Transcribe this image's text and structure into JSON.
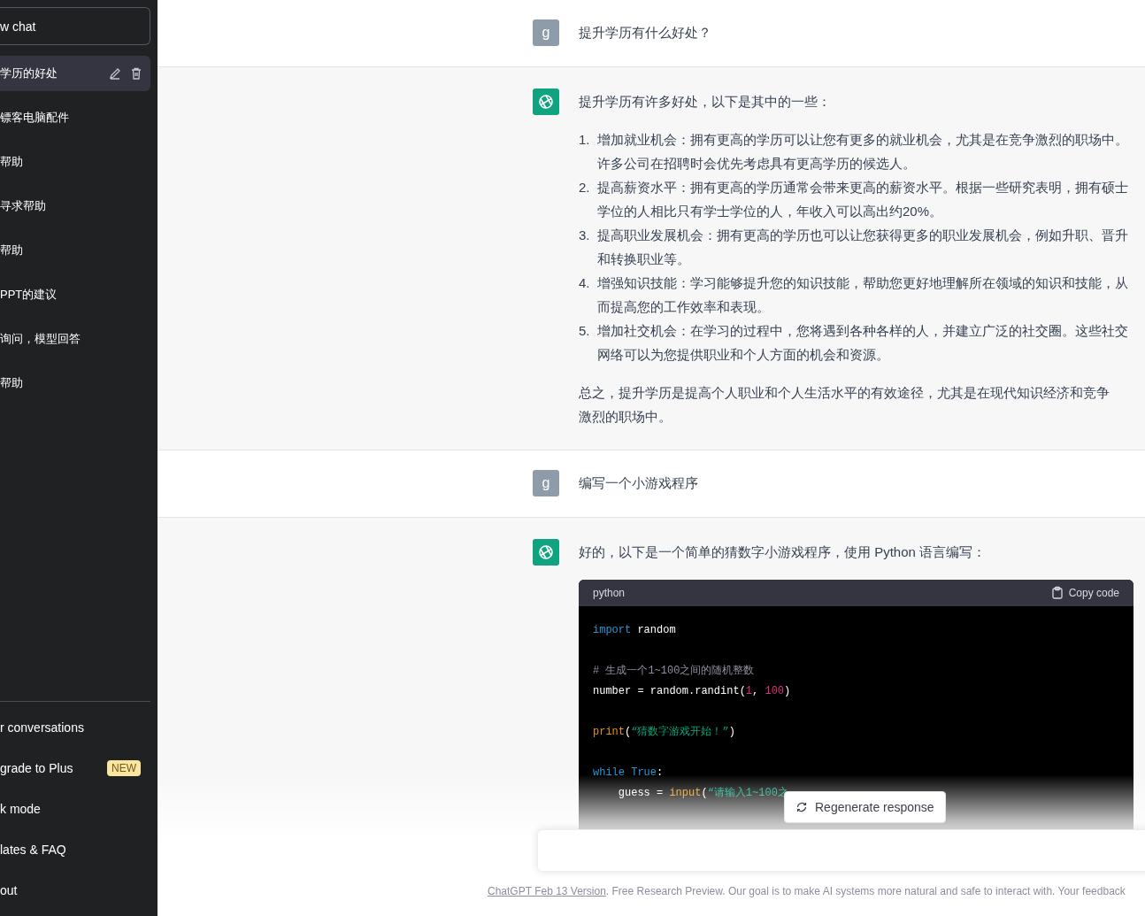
{
  "sidebar": {
    "new_chat": "w chat",
    "conversations": [
      {
        "title": "学历的好处",
        "selected": true
      },
      {
        "title": "镖客电脑配件",
        "selected": false
      },
      {
        "title": "帮助",
        "selected": false
      },
      {
        "title": "寻求帮助",
        "selected": false
      },
      {
        "title": "帮助",
        "selected": false
      },
      {
        "title": "PPT的建议",
        "selected": false
      },
      {
        "title": "询问，模型回答",
        "selected": false
      },
      {
        "title": "帮助",
        "selected": false
      }
    ],
    "menu": [
      {
        "label": "r conversations"
      },
      {
        "label": "grade to Plus",
        "badge": "NEW"
      },
      {
        "label": "k mode"
      },
      {
        "label": "lates & FAQ"
      },
      {
        "label": "out"
      }
    ]
  },
  "messages": [
    {
      "kind": "user",
      "avatar": "g",
      "text": "提升学历有什么好处？"
    },
    {
      "kind": "assistant",
      "intro": "提升学历有许多好处，以下是其中的一些：",
      "list": [
        {
          "number": "1.",
          "text": "增加就业机会：拥有更高的学历可以让您有更多的就业机会，尤其是在竞争激烈的职场中。许多公司在招聘时会优先考虑具有更高学历的候选人。"
        },
        {
          "number": "2.",
          "text": "提高薪资水平：拥有更高的学历通常会带来更高的薪资水平。根据一些研究表明，拥有硕士学位的人相比只有学士学位的人，年收入可以高出约20%。"
        },
        {
          "number": "3.",
          "text": "提高职业发展机会：拥有更高的学历也可以让您获得更多的职业发展机会，例如升职、晋升和转换职业等。"
        },
        {
          "number": "4.",
          "text": "增强知识技能：学习能够提升您的知识技能，帮助您更好地理解所在领域的知识和技能，从而提高您的工作效率和表现。"
        },
        {
          "number": "5.",
          "text": "增加社交机会：在学习的过程中，您将遇到各种各样的人，并建立广泛的社交圈。这些社交网络可以为您提供职业和个人方面的机会和资源。"
        }
      ],
      "outro": "总之，提升学历是提高个人职业和个人生活水平的有效途径，尤其是在现代知识经济和竞争激烈的职场中。"
    },
    {
      "kind": "user",
      "avatar": "g",
      "text": "编写一个小游戏程序"
    },
    {
      "kind": "assistant",
      "intro": "好的，以下是一个简单的猜数字小游戏程序，使用 Python 语言编写：",
      "code": {
        "language": "python",
        "copy_label": "Copy code",
        "groups": [
          {
            "lines": [
              {
                "tokens": [
                  {
                    "kind": "keyword",
                    "text": "import"
                  },
                  {
                    "kind": "plain",
                    "text": " random"
                  }
                ]
              }
            ]
          },
          {
            "lines": [
              {
                "tokens": [
                  {
                    "kind": "comment",
                    "text": "# 生成一个1~100之间的随机整数"
                  }
                ]
              },
              {
                "tokens": [
                  {
                    "kind": "plain",
                    "text": "number = random.randint("
                  },
                  {
                    "kind": "number",
                    "text": "1"
                  },
                  {
                    "kind": "plain",
                    "text": ", "
                  },
                  {
                    "kind": "number",
                    "text": "100"
                  },
                  {
                    "kind": "plain",
                    "text": ")"
                  }
                ]
              }
            ]
          },
          {
            "lines": [
              {
                "tokens": [
                  {
                    "kind": "builtin",
                    "text": "print"
                  },
                  {
                    "kind": "plain",
                    "text": "("
                  },
                  {
                    "kind": "string",
                    "text": "“猜数字游戏开始！”"
                  },
                  {
                    "kind": "plain",
                    "text": ")"
                  }
                ]
              }
            ]
          },
          {
            "lines": [
              {
                "tokens": [
                  {
                    "kind": "keyword",
                    "text": "while"
                  },
                  {
                    "kind": "keyword",
                    "text": " True"
                  },
                  {
                    "kind": "plain",
                    "text": ":"
                  }
                ]
              },
              {
                "tokens": [
                  {
                    "kind": "plain",
                    "text": "    guess = "
                  },
                  {
                    "kind": "builtin",
                    "text": "input"
                  },
                  {
                    "kind": "plain",
                    "text": "("
                  },
                  {
                    "kind": "string",
                    "text": "“请输入1~100之"
                  }
                ]
              }
            ]
          }
        ]
      }
    }
  ],
  "regenerate": "Regenerate response",
  "footer": {
    "link": "ChatGPT Feb 13 Version",
    "text": ". Free Research Preview. Our goal is to make AI systems more natural and safe to interact with. Your feedback"
  }
}
